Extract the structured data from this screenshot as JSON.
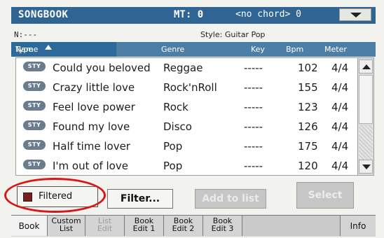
{
  "header": {
    "title": "SONGBOOK",
    "mt": "MT: 0",
    "chord": "<no chord> 0"
  },
  "info": {
    "n": "N:---",
    "style": "Style: Guitar Pop"
  },
  "columns": [
    "Type",
    "Name",
    "Genre",
    "Key",
    "Bpm",
    "Meter"
  ],
  "rows": [
    {
      "type": "STY",
      "name": "Could you beloved",
      "genre": "Reggae",
      "key": "-----",
      "bpm": "102",
      "meter": "4/4"
    },
    {
      "type": "STY",
      "name": "Crazy little love",
      "genre": "Rock'nRoll",
      "key": "-----",
      "bpm": "155",
      "meter": "4/4"
    },
    {
      "type": "STY",
      "name": "Feel love power",
      "genre": "Rock",
      "key": "-----",
      "bpm": "123",
      "meter": "4/4"
    },
    {
      "type": "STY",
      "name": "Found my love",
      "genre": "Disco",
      "key": "-----",
      "bpm": "126",
      "meter": "4/4"
    },
    {
      "type": "STY",
      "name": "Half time lover",
      "genre": "Pop",
      "key": "-----",
      "bpm": "175",
      "meter": "4/4"
    },
    {
      "type": "STY",
      "name": "I'm out of love",
      "genre": "Pop",
      "key": "-----",
      "bpm": "120",
      "meter": "4/4"
    }
  ],
  "controls": {
    "filtered": "Filtered",
    "filter_btn": "Filter...",
    "add_btn": "Add to list",
    "select_btn": "Select"
  },
  "tabs": [
    {
      "l1": "Book",
      "l2": ""
    },
    {
      "l1": "Custom",
      "l2": "List"
    },
    {
      "l1": "List",
      "l2": "Edit"
    },
    {
      "l1": "Book",
      "l2": "Edit 1"
    },
    {
      "l1": "Book",
      "l2": "Edit 2"
    },
    {
      "l1": "Book",
      "l2": "Edit 3"
    },
    {
      "l1": "",
      "l2": ""
    },
    {
      "l1": "Info",
      "l2": ""
    }
  ],
  "colors": {
    "header_bg": "#2f6493",
    "column_bg": "#4c7ea6",
    "filtered_indicator": "#7b1d1d",
    "annotation_ring": "#d81818"
  },
  "icons": {
    "sort": "sort-ascending-icon",
    "menu": "dropdown-arrow-icon",
    "scroll_up": "scroll-up-icon",
    "scroll_down": "scroll-down-icon"
  }
}
